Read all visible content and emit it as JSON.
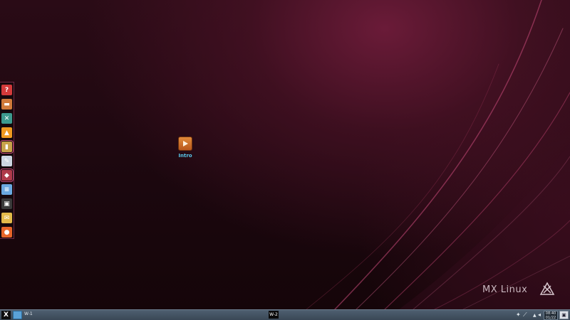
{
  "desktop": {
    "launcher": {
      "label": "Intro",
      "icon": "play-icon"
    },
    "logo": {
      "text": "MX Linux",
      "icon": "mx-logo-icon"
    }
  },
  "dock": {
    "items": [
      {
        "name": "help-icon",
        "glyph": "?",
        "color": "#d23a3a",
        "selected": false
      },
      {
        "name": "paint-roller-icon",
        "glyph": "▬",
        "color": "#d07a3a",
        "selected": false
      },
      {
        "name": "mx-tools-icon",
        "glyph": "✕",
        "color": "#3d9a8e",
        "selected": false
      },
      {
        "name": "vlc-cone-icon",
        "glyph": "▲",
        "color": "#f09a20",
        "selected": false
      },
      {
        "name": "file-manager-icon",
        "glyph": "▮",
        "color": "#c8a24a",
        "selected": true
      },
      {
        "name": "document-editor-icon",
        "glyph": "✎",
        "color": "#cdd6e2",
        "selected": false
      },
      {
        "name": "package-installer-icon",
        "glyph": "◆",
        "color": "#b03a4a",
        "selected": true
      },
      {
        "name": "document-icon",
        "glyph": "≡",
        "color": "#6aa9e0",
        "selected": false
      },
      {
        "name": "terminal-icon",
        "glyph": "▣",
        "color": "#3a3a3a",
        "selected": false
      },
      {
        "name": "mail-icon",
        "glyph": "✉",
        "color": "#e3b94a",
        "selected": false
      },
      {
        "name": "firefox-icon",
        "glyph": "●",
        "color": "#e8652a",
        "selected": false
      }
    ]
  },
  "taskbar": {
    "workspace1": "W-1",
    "workspace2": "W-2",
    "clock_time": "08:40",
    "clock_date": "01/22"
  }
}
